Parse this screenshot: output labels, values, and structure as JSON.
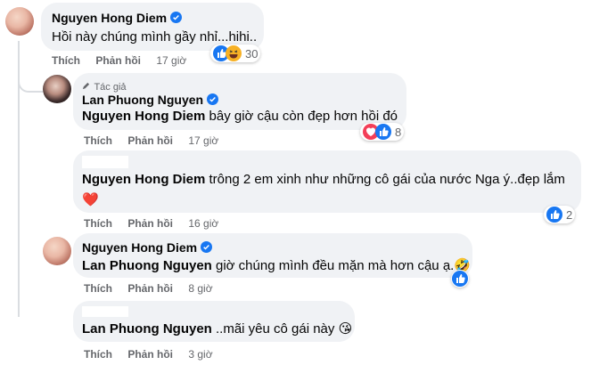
{
  "comments": [
    {
      "name": "Nguyen Hong Diem",
      "text": "Hồi này chúng mình gầy nhỉ...hihi..",
      "like": "Thích",
      "reply": "Phản hồi",
      "time": "17 giờ",
      "reactions": "30"
    },
    {
      "author_tag": "Tác giả",
      "name": "Lan Phuong Nguyen",
      "mention": "Nguyen Hong Diem",
      "text": "bây giờ cậu còn đẹp hơn hồi đó",
      "like": "Thích",
      "reply": "Phản hồi",
      "time": "17 giờ",
      "reactions": "8"
    },
    {
      "mention": "Nguyen Hong Diem",
      "text": "trông 2 em xinh như những cô gái của nước Nga ý..đẹp lắm",
      "emoji": "❤️",
      "like": "Thích",
      "reply": "Phản hồi",
      "time": "16 giờ",
      "reactions": "2"
    },
    {
      "name": "Nguyen Hong Diem",
      "mention": "Lan Phuong Nguyen",
      "text": "giờ chúng mình đều mặn mà hơn cậu ạ.",
      "emoji": "🤣",
      "like": "Thích",
      "reply": "Phản hồi",
      "time": "8 giờ"
    },
    {
      "mention": "Lan Phuong Nguyen",
      "text": "..mãi yêu cô gái này",
      "emoji": "😘",
      "like": "Thích",
      "reply": "Phản hồi",
      "time": "3 giờ"
    }
  ],
  "colors": {
    "bubble": "#f0f2f5",
    "verified": "#1877f2",
    "meta": "#65676b",
    "like": "#1877f2",
    "love": "#f33e58",
    "haha": "#f7b125"
  }
}
